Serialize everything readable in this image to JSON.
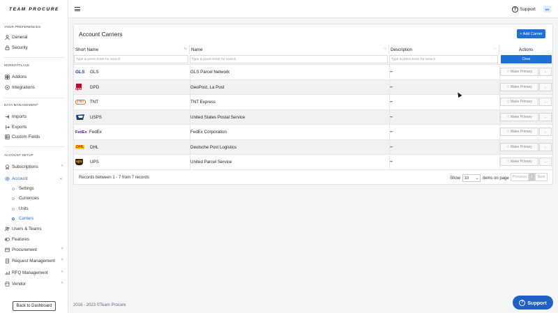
{
  "brand": {
    "logo": "TEAM PROCURE"
  },
  "sidebar": {
    "sections": [
      {
        "title": "YOUR PREFERENCES",
        "items": [
          {
            "label": "General",
            "icon": "user-icon"
          },
          {
            "label": "Security",
            "icon": "lock-icon"
          }
        ]
      },
      {
        "title": "MARKETPLACE",
        "items": [
          {
            "label": "Addons",
            "icon": "grid-icon"
          },
          {
            "label": "Integrations",
            "icon": "plug-icon"
          }
        ]
      },
      {
        "title": "DATA MANAGEMENT",
        "items": [
          {
            "label": "Imports",
            "icon": "import-icon"
          },
          {
            "label": "Exports",
            "icon": "export-icon"
          },
          {
            "label": "Custom Fields",
            "icon": "fields-icon"
          }
        ]
      },
      {
        "title": "ACCOUNT SETUP",
        "items": [
          {
            "label": "Subscriptions",
            "icon": "medal-icon"
          },
          {
            "label": "Account",
            "icon": "gear-icon"
          },
          {
            "label": "Users & Teams",
            "icon": "users-icon"
          },
          {
            "label": "Features",
            "icon": "toggle-icon"
          },
          {
            "label": "Procurement",
            "icon": "document-icon"
          },
          {
            "label": "Request Management",
            "icon": "request-icon"
          },
          {
            "label": "RFQ Management",
            "icon": "chart-icon"
          },
          {
            "label": "Vendor",
            "icon": "store-icon"
          }
        ]
      }
    ],
    "account_sub": [
      "Settings",
      "Currencies",
      "Units",
      "Carriers"
    ],
    "back_button": "Back to Dashboard"
  },
  "topbar": {
    "support": "Support",
    "avatar": "NH"
  },
  "card": {
    "title": "Account Carriers",
    "add_button": "+ Add Carrier",
    "columns": {
      "short_name": "Short Name",
      "name": "Name",
      "description": "Description",
      "actions": "Actions"
    },
    "filter_placeholder": "Type & press Enter for search",
    "clear": "Clear",
    "rows": [
      {
        "logo": "GLS",
        "short": "GLS",
        "name": "GLS Parcel Network",
        "desc": "–"
      },
      {
        "logo": "dpd",
        "short": "DPD",
        "name": "GeoPost, La Post",
        "desc": "–"
      },
      {
        "logo": "TNT",
        "short": "TNT",
        "name": "TNT Express",
        "desc": "–"
      },
      {
        "logo": "USPS",
        "short": "USPS",
        "name": "United States Postal Service",
        "desc": "–"
      },
      {
        "logo": "FedEx",
        "short": "FedEx",
        "name": "FedEx Corporation",
        "desc": "–"
      },
      {
        "logo": "DHL",
        "short": "DHL",
        "name": "Deutsche Post Logistics",
        "desc": "–"
      },
      {
        "logo": "ups",
        "short": "UPS",
        "name": "United Parcel Service",
        "desc": "–"
      }
    ],
    "make_primary": "Make Primary",
    "records_text": "Records between 1 - 7 from 7 records",
    "show_label": "Show",
    "page_size": "10",
    "items_on_page": "items on page",
    "pager": {
      "previous": "Previous",
      "current": "1",
      "next": "Next"
    }
  },
  "footer": {
    "copyright": "2016 - 2023 ©Team Procure"
  },
  "support_fab": "Support",
  "colors": {
    "primary": "#1f6fd8",
    "active_nav": "#2c6ed5",
    "row_alt": "#f1f1f1"
  }
}
